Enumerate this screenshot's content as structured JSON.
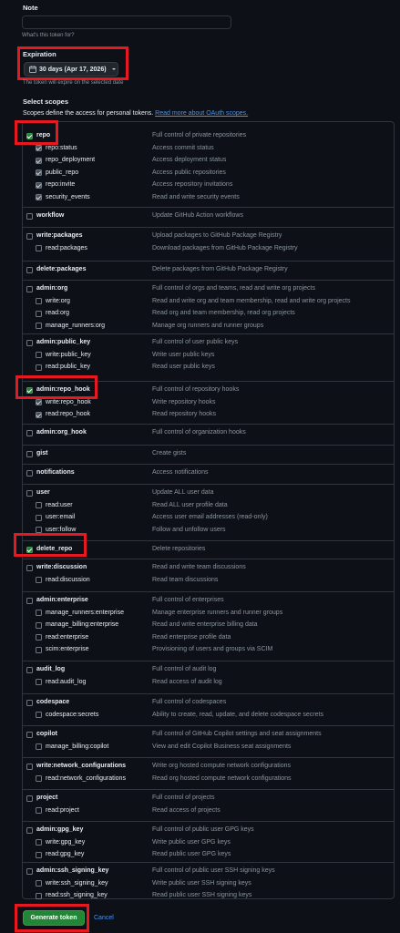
{
  "note": {
    "label": "Note",
    "value": "",
    "help": "What's this token for?"
  },
  "expiration": {
    "label": "Expiration",
    "value": "30 days (Apr 17, 2026)",
    "help": "The token will expire on the selected date"
  },
  "scopes": {
    "title": "Select scopes",
    "description": "Scopes define the access for personal tokens.",
    "link": "Read more about OAuth scopes.",
    "groups": [
      {
        "name": "repo",
        "desc": "Full control of private repositories",
        "checked": true,
        "children": [
          {
            "name": "repo:status",
            "desc": "Access commit status",
            "checked": true
          },
          {
            "name": "repo_deployment",
            "desc": "Access deployment status",
            "checked": true
          },
          {
            "name": "public_repo",
            "desc": "Access public repositories",
            "checked": true
          },
          {
            "name": "repo:invite",
            "desc": "Access repository invitations",
            "checked": true
          },
          {
            "name": "security_events",
            "desc": "Read and write security events",
            "checked": true
          }
        ]
      },
      {
        "name": "workflow",
        "desc": "Update GitHub Action workflows",
        "checked": false,
        "children": []
      },
      {
        "name": "write:packages",
        "desc": "Upload packages to GitHub Package Registry",
        "checked": false,
        "children": [
          {
            "name": "read:packages",
            "desc": "Download packages from GitHub Package Registry",
            "checked": false
          }
        ]
      },
      {
        "name": "delete:packages",
        "desc": "Delete packages from GitHub Package Registry",
        "checked": false,
        "children": []
      },
      {
        "name": "admin:org",
        "desc": "Full control of orgs and teams, read and write org projects",
        "checked": false,
        "children": [
          {
            "name": "write:org",
            "desc": "Read and write org and team membership, read and write org projects",
            "checked": false
          },
          {
            "name": "read:org",
            "desc": "Read org and team membership, read org projects",
            "checked": false
          },
          {
            "name": "manage_runners:org",
            "desc": "Manage org runners and runner groups",
            "checked": false
          }
        ]
      },
      {
        "name": "admin:public_key",
        "desc": "Full control of user public keys",
        "checked": false,
        "children": [
          {
            "name": "write:public_key",
            "desc": "Write user public keys",
            "checked": false
          },
          {
            "name": "read:public_key",
            "desc": "Read user public keys",
            "checked": false
          }
        ]
      },
      {
        "name": "admin:repo_hook",
        "desc": "Full control of repository hooks",
        "checked": true,
        "children": [
          {
            "name": "write:repo_hook",
            "desc": "Write repository hooks",
            "checked": true
          },
          {
            "name": "read:repo_hook",
            "desc": "Read repository hooks",
            "checked": true
          }
        ]
      },
      {
        "name": "admin:org_hook",
        "desc": "Full control of organization hooks",
        "checked": false,
        "children": []
      },
      {
        "name": "gist",
        "desc": "Create gists",
        "checked": false,
        "children": []
      },
      {
        "name": "notifications",
        "desc": "Access notifications",
        "checked": false,
        "children": []
      },
      {
        "name": "user",
        "desc": "Update ALL user data",
        "checked": false,
        "children": [
          {
            "name": "read:user",
            "desc": "Read ALL user profile data",
            "checked": false
          },
          {
            "name": "user:email",
            "desc": "Access user email addresses (read-only)",
            "checked": false
          },
          {
            "name": "user:follow",
            "desc": "Follow and unfollow users",
            "checked": false
          }
        ]
      },
      {
        "name": "delete_repo",
        "desc": "Delete repositories",
        "checked": true,
        "children": []
      },
      {
        "name": "write:discussion",
        "desc": "Read and write team discussions",
        "checked": false,
        "children": [
          {
            "name": "read:discussion",
            "desc": "Read team discussions",
            "checked": false
          }
        ]
      },
      {
        "name": "admin:enterprise",
        "desc": "Full control of enterprises",
        "checked": false,
        "children": [
          {
            "name": "manage_runners:enterprise",
            "desc": "Manage enterprise runners and runner groups",
            "checked": false
          },
          {
            "name": "manage_billing:enterprise",
            "desc": "Read and write enterprise billing data",
            "checked": false
          },
          {
            "name": "read:enterprise",
            "desc": "Read enterprise profile data",
            "checked": false
          },
          {
            "name": "scim:enterprise",
            "desc": "Provisioning of users and groups via SCIM",
            "checked": false
          }
        ]
      },
      {
        "name": "audit_log",
        "desc": "Full control of audit log",
        "checked": false,
        "children": [
          {
            "name": "read:audit_log",
            "desc": "Read access of audit log",
            "checked": false
          }
        ]
      },
      {
        "name": "codespace",
        "desc": "Full control of codespaces",
        "checked": false,
        "children": [
          {
            "name": "codespace:secrets",
            "desc": "Ability to create, read, update, and delete codespace secrets",
            "checked": false
          }
        ]
      },
      {
        "name": "copilot",
        "desc": "Full control of GitHub Copilot settings and seat assignments",
        "checked": false,
        "children": [
          {
            "name": "manage_billing:copilot",
            "desc": "View and edit Copilot Business seat assignments",
            "checked": false
          }
        ]
      },
      {
        "name": "write:network_configurations",
        "desc": "Write org hosted compute network configurations",
        "checked": false,
        "children": [
          {
            "name": "read:network_configurations",
            "desc": "Read org hosted compute network configurations",
            "checked": false
          }
        ]
      },
      {
        "name": "project",
        "desc": "Full control of projects",
        "checked": false,
        "children": [
          {
            "name": "read:project",
            "desc": "Read access of projects",
            "checked": false
          }
        ]
      },
      {
        "name": "admin:gpg_key",
        "desc": "Full control of public user GPG keys",
        "checked": false,
        "children": [
          {
            "name": "write:gpg_key",
            "desc": "Write public user GPG keys",
            "checked": false
          },
          {
            "name": "read:gpg_key",
            "desc": "Read public user GPG keys",
            "checked": false
          }
        ]
      },
      {
        "name": "admin:ssh_signing_key",
        "desc": "Full control of public user SSH signing keys",
        "checked": false,
        "children": [
          {
            "name": "write:ssh_signing_key",
            "desc": "Write public user SSH signing keys",
            "checked": false
          },
          {
            "name": "read:ssh_signing_key",
            "desc": "Read public user SSH signing keys",
            "checked": false
          }
        ]
      }
    ]
  },
  "actions": {
    "generate": "Generate token",
    "cancel": "Cancel"
  },
  "colors": {
    "background": "#0d1117",
    "accent_green": "#238636",
    "link_blue": "#4493f8",
    "highlight_red": "#e5191f"
  }
}
